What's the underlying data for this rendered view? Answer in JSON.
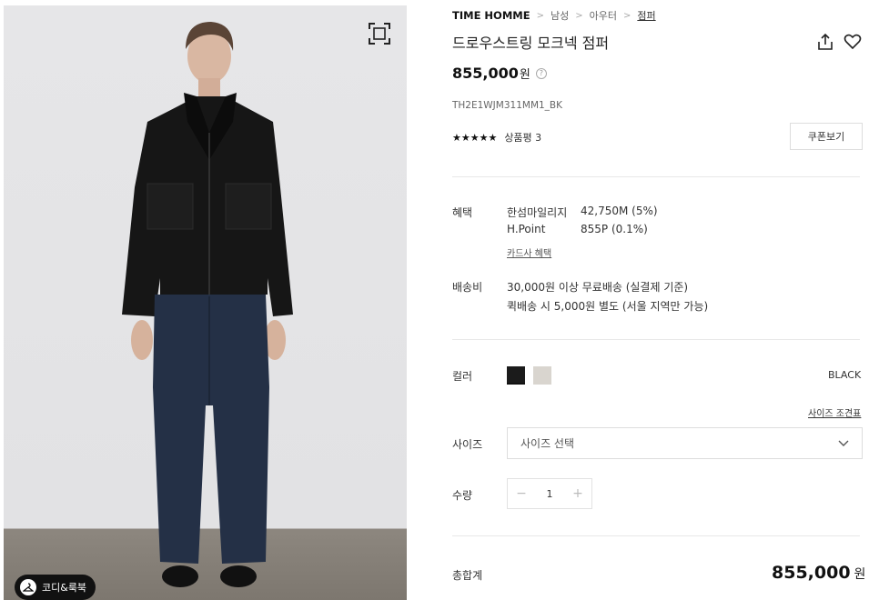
{
  "gallery": {
    "lookbook_label": "코디&룩북"
  },
  "breadcrumb": {
    "brand": "TIME HOMME",
    "items": [
      "남성",
      "아우터",
      "점퍼"
    ]
  },
  "product": {
    "title": "드로우스트링 모크넥 점퍼",
    "price": "855,000",
    "price_unit": "원",
    "code": "TH2E1WJM311MM1_BK",
    "stars": "★★★★★",
    "review_label": "상품평 3",
    "coupon_label": "쿠폰보기"
  },
  "benefits": {
    "label": "혜택",
    "rows": [
      {
        "name": "한섬마일리지",
        "value": "42,750M (5%)"
      },
      {
        "name": "H.Point",
        "value": "855P (0.1%)"
      }
    ],
    "card_link": "카드사 혜택"
  },
  "shipping": {
    "label": "배송비",
    "line1": "30,000원 이상 무료배송 (실결제 기준)",
    "line2": "퀵배송 시 5,000원 별도 (서울 지역만 가능)"
  },
  "color": {
    "label": "컬러",
    "selected": "BLACK",
    "swatches": [
      "#1b1b1b",
      "#d9d5cf"
    ]
  },
  "size": {
    "chart_link": "사이즈 조견표",
    "label": "사이즈",
    "placeholder": "사이즈 선택"
  },
  "quantity": {
    "label": "수량",
    "minus": "−",
    "value": "1",
    "plus": "+"
  },
  "total": {
    "label": "총합계",
    "amount": "855,000",
    "unit": "원"
  }
}
